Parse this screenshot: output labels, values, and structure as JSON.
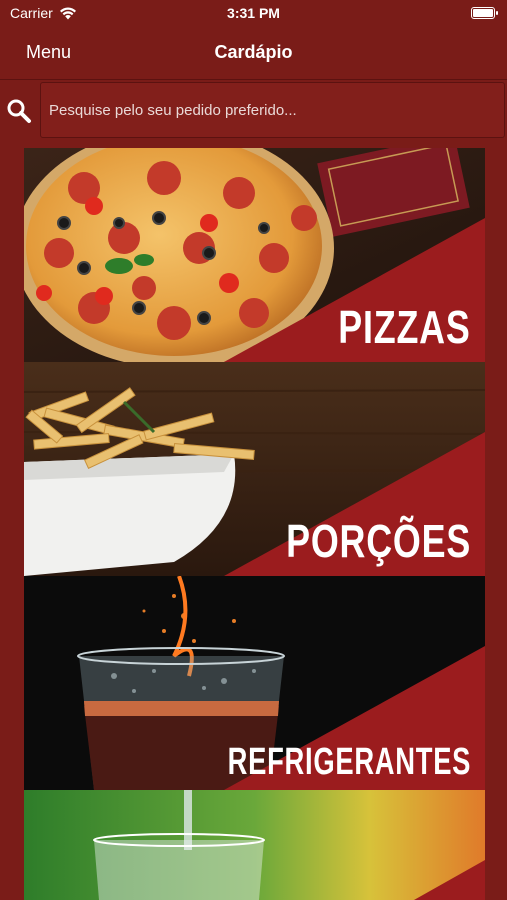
{
  "status_bar": {
    "carrier": "Carrier",
    "time": "3:31 PM"
  },
  "nav": {
    "menu_label": "Menu",
    "title": "Cardápio"
  },
  "search": {
    "placeholder": "Pesquise pelo seu pedido preferido..."
  },
  "categories": [
    {
      "label": "PIZZAS"
    },
    {
      "label": "PORÇÕES"
    },
    {
      "label": "REFRIGERANTES"
    },
    {
      "label": ""
    }
  ],
  "colors": {
    "background": "#7a1c18",
    "accent": "#9b1c1e"
  }
}
